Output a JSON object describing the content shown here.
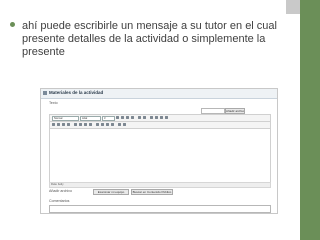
{
  "slide": {
    "bullet": "ahí puede escribirle un mensaje a su tutor en el cual presente detalles de la actividad o simplemente la presente"
  },
  "screenshot": {
    "title": "Materiales de la actividad",
    "field_label_top": "Texto",
    "upload_button": "Añadir archivo",
    "toolbar": {
      "style_select": "Normal",
      "font_select": "Arial",
      "size_select": "3"
    },
    "path_text": "Ruta: body",
    "row1_label": "Añadir archivo",
    "row1_button_a": "Examinar mi equipo",
    "row1_button_b": "Buscar en Contenido Público",
    "row2_label": "Comentarios"
  },
  "colors": {
    "accent": "#6b8f58",
    "text": "#404040"
  }
}
